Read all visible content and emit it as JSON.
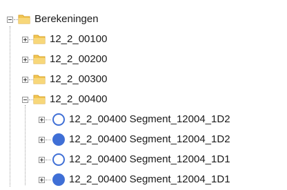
{
  "tree": {
    "root": {
      "label": "Berekeningen",
      "expanded": true,
      "icon": "folder-icon"
    },
    "folders": [
      {
        "label": "12_2_00100",
        "expanded": false,
        "icon": "folder-icon"
      },
      {
        "label": "12_2_00200",
        "expanded": false,
        "icon": "folder-icon"
      },
      {
        "label": "12_2_00300",
        "expanded": false,
        "icon": "folder-icon"
      },
      {
        "label": "12_2_00400",
        "expanded": true,
        "icon": "folder-icon"
      }
    ],
    "segments": [
      {
        "label": "12_2_00400 Segment_12004_1D2",
        "icon": "open-circle-icon"
      },
      {
        "label": "12_2_00400 Segment_12004_1D2",
        "icon": "filled-circle-icon"
      },
      {
        "label": "12_2_00400 Segment_12004_1D1",
        "icon": "open-circle-icon"
      },
      {
        "label": "12_2_00400 Segment_12004_1D1",
        "icon": "filled-circle-icon"
      }
    ]
  },
  "colors": {
    "folder": "#f2c552",
    "circle": "#3f6fd6",
    "connector": "#a0a0a0"
  }
}
